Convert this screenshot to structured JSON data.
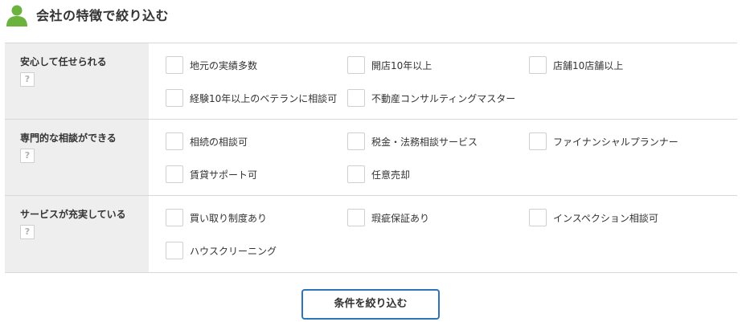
{
  "header": {
    "title": "会社の特徴で絞り込む",
    "icon": "person-icon",
    "icon_color": "#6cb33e"
  },
  "rows": [
    {
      "label": "安心して任せられる",
      "help": "?",
      "options": [
        "地元の実績多数",
        "開店10年以上",
        "店舗10店舗以上",
        "経験10年以上のベテランに相談可",
        "不動産コンサルティングマスター"
      ]
    },
    {
      "label": "専門的な相談ができる",
      "help": "?",
      "options": [
        "相続の相談可",
        "税金・法務相談サービス",
        "ファイナンシャルプランナー",
        "賃貸サポート可",
        "任意売却"
      ]
    },
    {
      "label": "サービスが充実している",
      "help": "?",
      "options": [
        "買い取り制度あり",
        "瑕疵保証あり",
        "インスペクション相談可",
        "ハウスクリーニング"
      ]
    }
  ],
  "submit_label": "条件を絞り込む",
  "colors": {
    "accent": "#2f73b8",
    "row_head_bg": "#eeeeee",
    "border": "#d8d8d8"
  }
}
